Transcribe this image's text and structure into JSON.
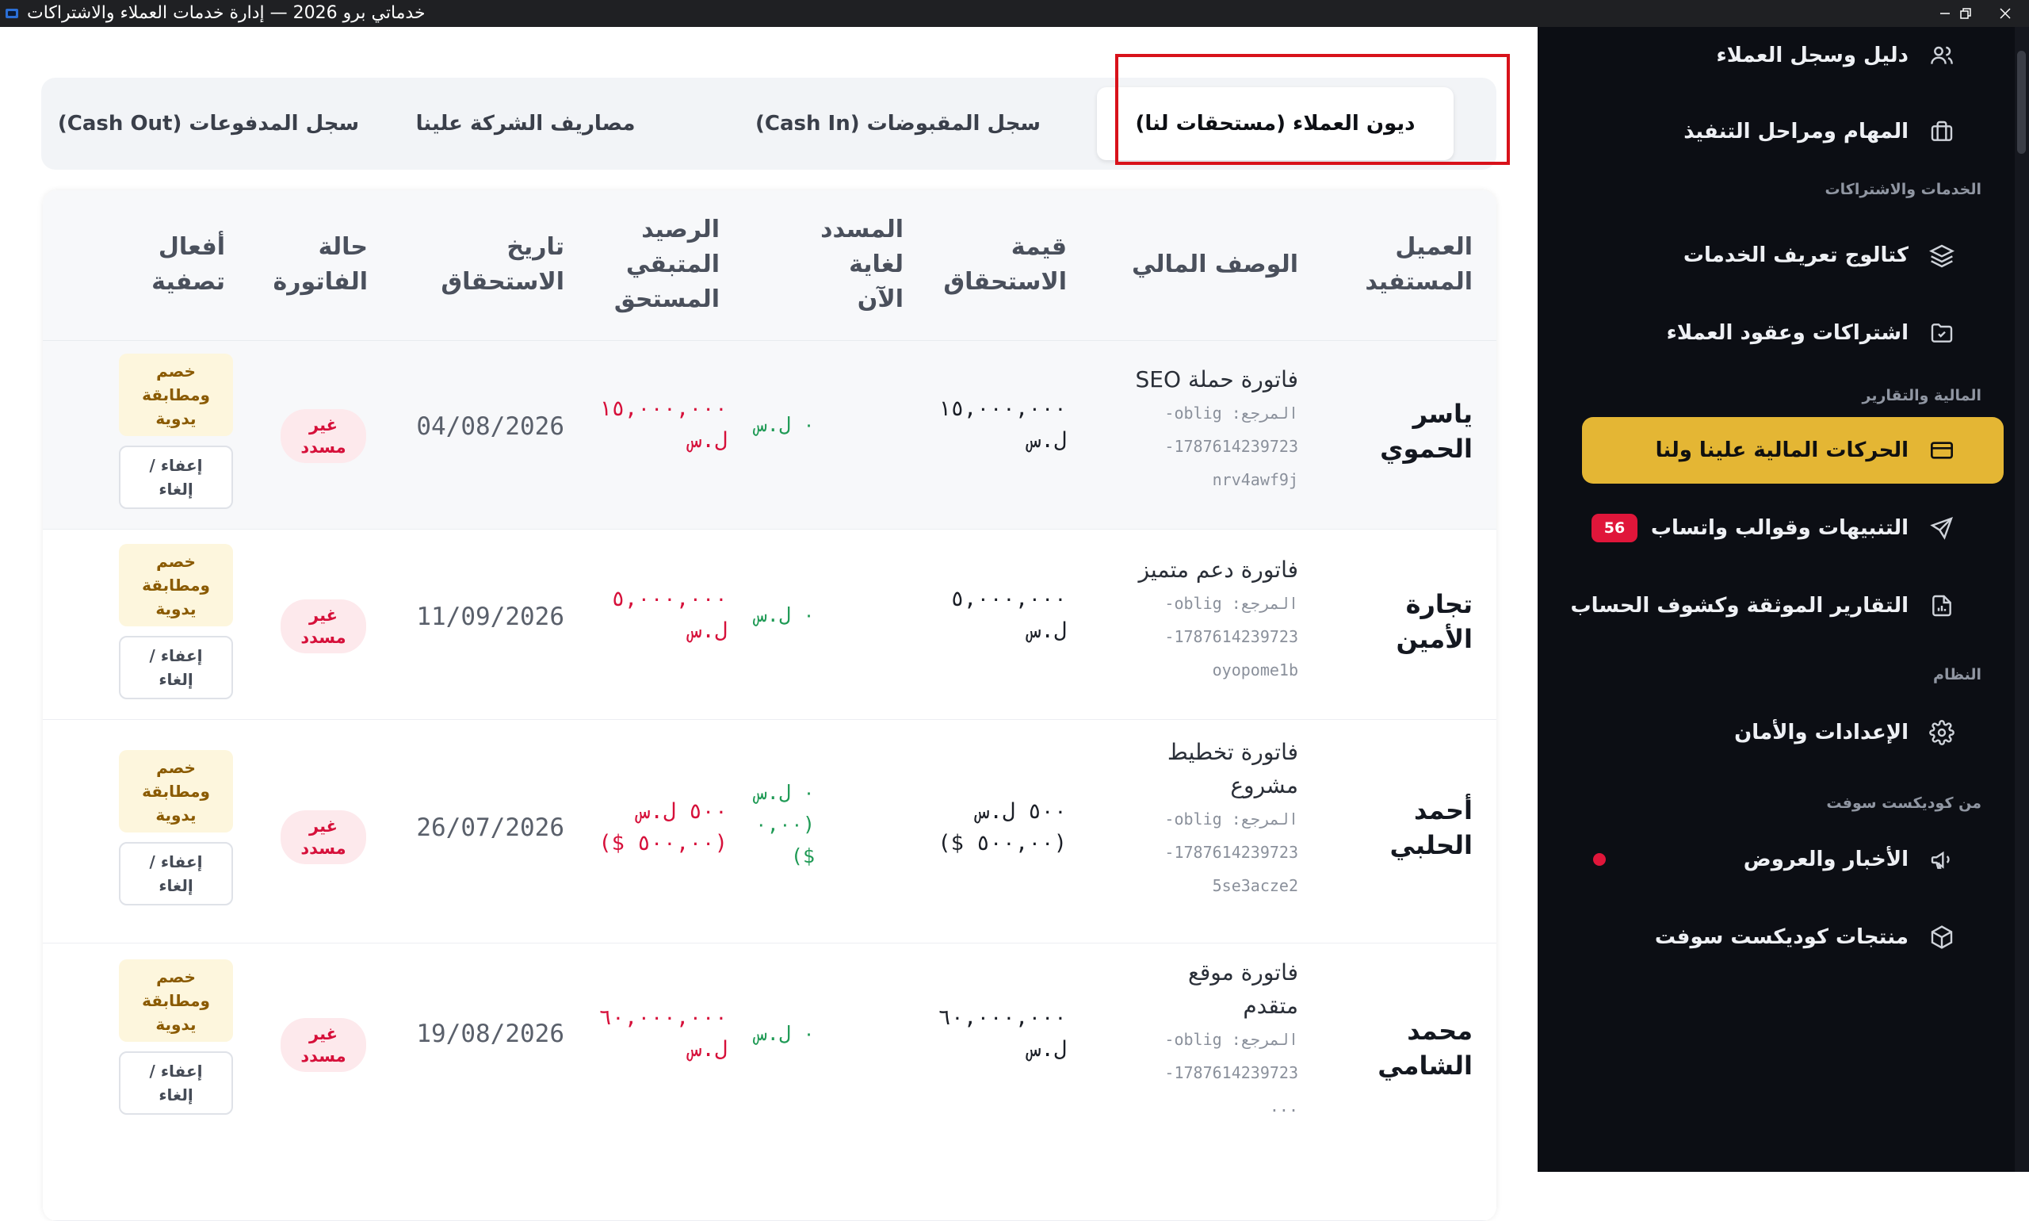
{
  "window": {
    "title": "خدماتي برو 2026 — إدارة خدمات العملاء والاشتراكات"
  },
  "sidebar": {
    "items": [
      {
        "label": "دليل وسجل العملاء",
        "icon": "users-icon"
      },
      {
        "label": "المهام ومراحل التنفيذ",
        "icon": "briefcase-icon"
      },
      {
        "label": "كتالوج تعريف الخدمات",
        "icon": "layers-icon"
      },
      {
        "label": "اشتراكات وعقود العملاء",
        "icon": "folder-check-icon"
      },
      {
        "label": "الحركات المالية علينا ولنا",
        "icon": "credit-card-icon",
        "active": true
      },
      {
        "label": "التنبيهات وقوالب واتساب",
        "icon": "send-icon",
        "badge": "56"
      },
      {
        "label": "التقارير الموثقة وكشوف الحساب",
        "icon": "report-icon"
      },
      {
        "label": "الإعدادات والأمان",
        "icon": "gear-icon"
      },
      {
        "label": "الأخبار والعروض",
        "icon": "megaphone-icon",
        "dot": true
      },
      {
        "label": "منتجات كوديكست سوفت",
        "icon": "package-icon"
      }
    ],
    "sections": {
      "services": "الخدمات والاشتراكات",
      "finance": "المالية والتقارير",
      "system": "النظام",
      "vendor": "من كوديكست سوفت"
    }
  },
  "tabs": [
    {
      "label": "ديون العملاء (مستحقات لنا)",
      "active": true
    },
    {
      "label": "سجل المقبوضات (Cash In)"
    },
    {
      "label": "مصاريف الشركة علينا"
    },
    {
      "label": "سجل المدفوعات (Cash Out)"
    }
  ],
  "table": {
    "headers": {
      "client": [
        "العميل",
        "المستفيد"
      ],
      "desc": [
        "الوصف المالي"
      ],
      "amount": [
        "قيمة",
        "الاستحقاق"
      ],
      "paid": [
        "المسدد",
        "لغاية",
        "الآن"
      ],
      "remaining": [
        "الرصيد",
        "المتبقي",
        "المستحق"
      ],
      "due": [
        "تاريخ",
        "الاستحقاق"
      ],
      "status": [
        "حالة",
        "الفاتورة"
      ],
      "actions": [
        "أفعال",
        "تصفية"
      ]
    },
    "rows": [
      {
        "client": [
          "ياسر",
          "الحموي"
        ],
        "desc_title": [
          "فاتورة حملة SEO"
        ],
        "ref": [
          "المرجع: oblig-",
          "1787614239723-",
          "nrv4awf9j"
        ],
        "amount": [
          "١٥,٠٠٠,٠٠٠",
          "ل.س"
        ],
        "paid": [
          "٠ ل.س"
        ],
        "remaining": [
          "١٥,٠٠٠,٠٠٠",
          "ل.س"
        ],
        "due": "04/08/2026",
        "status": [
          "غير",
          "مسدد"
        ],
        "settle": [
          "خصم",
          "ومطابقة",
          "يدوية"
        ],
        "waive": [
          "إعفاء /",
          "إلغاء"
        ]
      },
      {
        "client": [
          "تجارة",
          "الأمين"
        ],
        "desc_title": [
          "فاتورة دعم متميز"
        ],
        "ref": [
          "المرجع: oblig-",
          "1787614239723-",
          "oyopome1b"
        ],
        "amount": [
          "٥,٠٠٠,٠٠٠",
          "ل.س"
        ],
        "paid": [
          "٠ ل.س"
        ],
        "remaining": [
          "٥,٠٠٠,٠٠٠",
          "ل.س"
        ],
        "due": "11/09/2026",
        "status": [
          "غير",
          "مسدد"
        ],
        "settle": [
          "خصم",
          "ومطابقة",
          "يدوية"
        ],
        "waive": [
          "إعفاء /",
          "إلغاء"
        ]
      },
      {
        "client": [
          "أحمد",
          "الحلبي"
        ],
        "desc_title": [
          "فاتورة تخطيط",
          "مشروع"
        ],
        "ref": [
          "المرجع: oblig-",
          "1787614239723-",
          "5se3acze2"
        ],
        "amount": [
          "٥٠٠ ل.س",
          "(٥٠٠,٠٠ $)"
        ],
        "paid": [
          "٠ ل.س",
          "(٠,٠٠",
          "$)"
        ],
        "remaining": [
          "٥٠٠ ل.س",
          "(٥٠٠,٠٠ $)"
        ],
        "due": "26/07/2026",
        "status": [
          "غير",
          "مسدد"
        ],
        "settle": [
          "خصم",
          "ومطابقة",
          "يدوية"
        ],
        "waive": [
          "إعفاء /",
          "إلغاء"
        ]
      },
      {
        "client": [
          "محمد",
          "الشامي"
        ],
        "desc_title": [
          "فاتورة موقع",
          "متقدم"
        ],
        "ref": [
          "المرجع: oblig-",
          "1787614239723-",
          "..."
        ],
        "amount": [
          "٦٠,٠٠٠,٠٠٠",
          "ل.س"
        ],
        "paid": [
          "٠ ل.س"
        ],
        "remaining": [
          "٦٠,٠٠٠,٠٠٠",
          "ل.س"
        ],
        "due": "19/08/2026",
        "status": [
          "غير",
          "مسدد"
        ],
        "settle": [
          "خصم",
          "ومطابقة",
          "يدوية"
        ],
        "waive": [
          "إعفاء /",
          "إلغاء"
        ]
      }
    ]
  },
  "colors": {
    "accent": "#e4b634",
    "sidebar_bg": "#0c0e14",
    "danger": "#d6103a",
    "success": "#1f9a55",
    "highlight_border": "#d8121b"
  }
}
